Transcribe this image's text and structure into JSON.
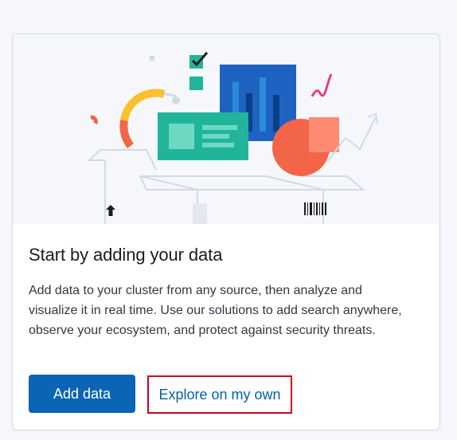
{
  "card": {
    "title": "Start by adding your data",
    "description": "Add data to your cluster from any source, then analyze and visualize it in real time. Use our solutions to add search anywhere, observe your ecosystem, and protect against security threats.",
    "add_data_label": "Add data",
    "explore_label": "Explore on my own"
  },
  "illustration": {
    "icons": [
      "box-icon",
      "bar-chart-icon",
      "card-icon",
      "pie-chart-icon",
      "donut-chart-icon",
      "checkbox-icon",
      "barcode-icon",
      "up-arrow-icon",
      "trend-line-icon",
      "squiggle-icon"
    ]
  },
  "colors": {
    "primary_button": "#0b64b4",
    "link": "#0061a6",
    "highlight_border": "#d0021b",
    "teal": "#20b59b",
    "blue": "#1e63c2",
    "coral": "#f36548",
    "yellow": "#fbc02d",
    "magenta": "#e0408f"
  }
}
